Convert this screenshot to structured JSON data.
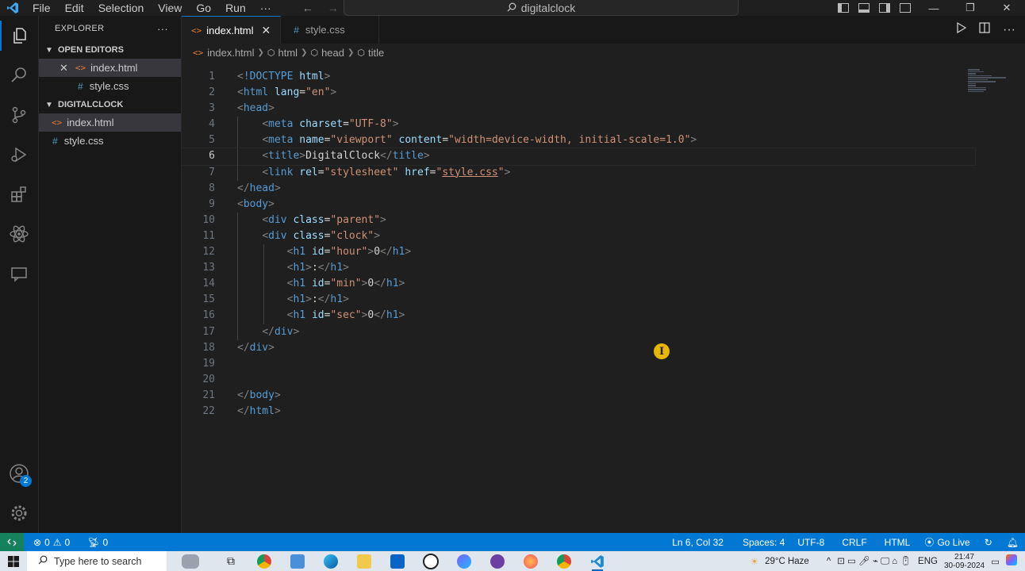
{
  "menu": [
    "File",
    "Edit",
    "Selection",
    "View",
    "Go",
    "Run",
    "···"
  ],
  "search": {
    "text": "digitalclock"
  },
  "sidebar": {
    "title": "EXPLORER",
    "more": "···",
    "open_editors": {
      "header": "OPEN EDITORS",
      "items": [
        {
          "name": "index.html",
          "close": "✕"
        },
        {
          "name": "style.css"
        }
      ]
    },
    "project": {
      "header": "DIGITALCLOCK",
      "items": [
        {
          "name": "index.html"
        },
        {
          "name": "style.css"
        }
      ]
    }
  },
  "tabs": [
    {
      "label": "index.html",
      "close": "✕"
    },
    {
      "label": "style.css"
    }
  ],
  "breadcrumb": [
    "index.html",
    "html",
    "head",
    "title"
  ],
  "code_lines": [
    "1",
    "2",
    "3",
    "4",
    "5",
    "6",
    "7",
    "8",
    "9",
    "10",
    "11",
    "12",
    "13",
    "14",
    "15",
    "16",
    "17",
    "18",
    "19",
    "20",
    "21",
    "22"
  ],
  "code": {
    "doctype": "!DOCTYPE",
    "doctype_val": "html",
    "lang_val": "\"en\"",
    "charset_val": "\"UTF-8\"",
    "name_val": "\"viewport\"",
    "content_val": "\"width=device-width, initial-scale=1.0\"",
    "title_text": "DigitalClock",
    "rel_val": "\"stylesheet\"",
    "href_val": "style.css",
    "parent_val": "\"parent\"",
    "clock_val": "\"clock\"",
    "hour_val": "\"hour\"",
    "min_val": "\"min\"",
    "sec_val": "\"sec\"",
    "zero": "0",
    "colon": ":"
  },
  "status": {
    "errors": "0",
    "warnings": "0",
    "ports": "0",
    "position": "Ln 6, Col 32",
    "spaces": "Spaces: 4",
    "encoding": "UTF-8",
    "eol": "CRLF",
    "language": "HTML",
    "golive": "Go Live"
  },
  "accounts_badge": "2",
  "taskbar": {
    "search_placeholder": "Type here to search",
    "weather": "29°C  Haze",
    "lang": "ENG",
    "time": "21:47",
    "date": "30-09-2024"
  },
  "colors": {
    "accent": "#0078d4",
    "status_bg": "#0078d4"
  }
}
